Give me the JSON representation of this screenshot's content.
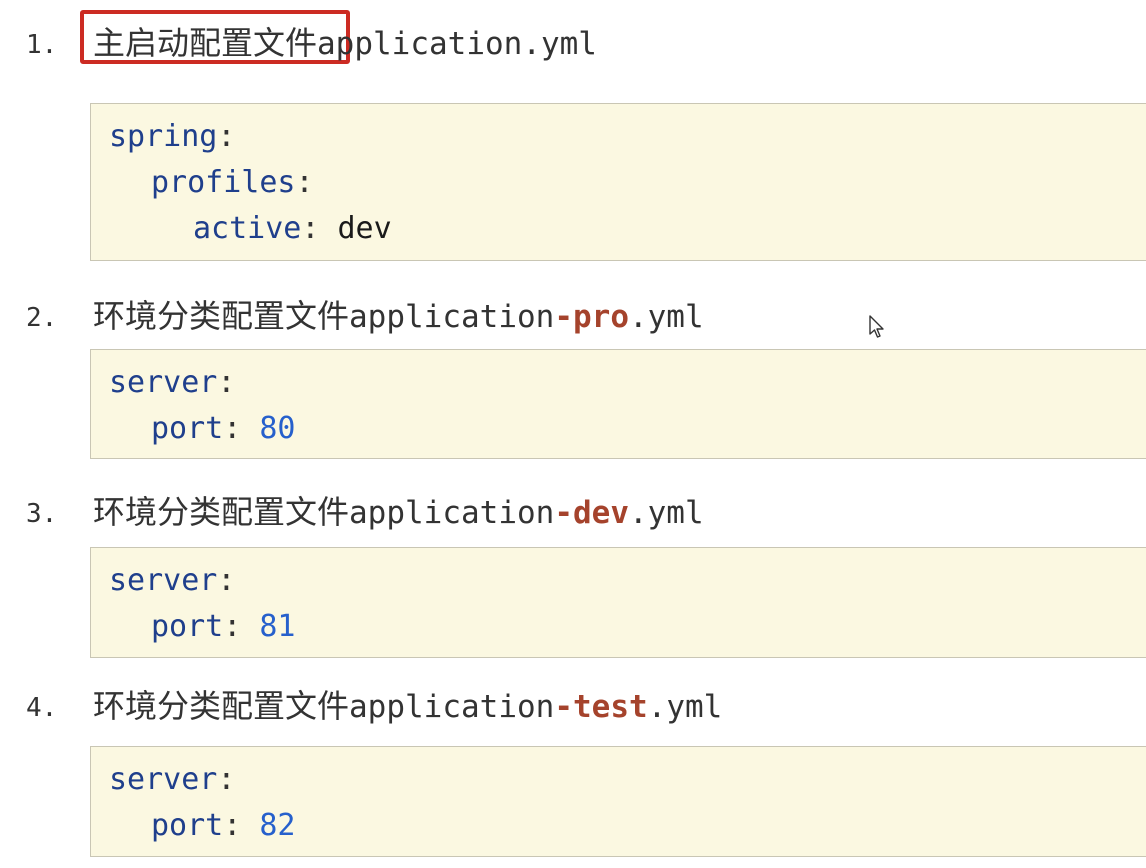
{
  "sections": [
    {
      "number": "1.",
      "title_cn": "主启动配置文件",
      "title_file": "application.yml",
      "highlighted": true,
      "code": [
        {
          "key": "spring",
          "sep": ":",
          "value": ""
        },
        {
          "key": "profiles",
          "sep": ":",
          "value": ""
        },
        {
          "key": "active",
          "sep": ": ",
          "value": "dev"
        }
      ]
    },
    {
      "number": "2.",
      "title_cn": "环境分类配置文件",
      "title_file_prefix": "application",
      "title_file_accent": "-pro",
      "title_file_suffix": ".yml",
      "code": [
        {
          "key": "server",
          "sep": ":",
          "value": ""
        },
        {
          "key": "port",
          "sep": ": ",
          "value": "80"
        }
      ]
    },
    {
      "number": "3.",
      "title_cn": "环境分类配置文件",
      "title_file_prefix": "application",
      "title_file_accent": "-dev",
      "title_file_suffix": ".yml",
      "code": [
        {
          "key": "server",
          "sep": ":",
          "value": ""
        },
        {
          "key": "port",
          "sep": ": ",
          "value": "81"
        }
      ]
    },
    {
      "number": "4.",
      "title_cn": "环境分类配置文件",
      "title_file_prefix": "application",
      "title_file_accent": "-test",
      "title_file_suffix": ".yml",
      "code": [
        {
          "key": "server",
          "sep": ":",
          "value": ""
        },
        {
          "key": "port",
          "sep": ": ",
          "value": "82"
        }
      ]
    }
  ],
  "colors": {
    "accent": "#a5432c",
    "key": "#1f3f8c",
    "number_value": "#2660cc",
    "highlight_border": "#cc2b23",
    "code_bg": "#fbf8e1"
  },
  "icons": {
    "cursor": "mouse-pointer-icon"
  }
}
